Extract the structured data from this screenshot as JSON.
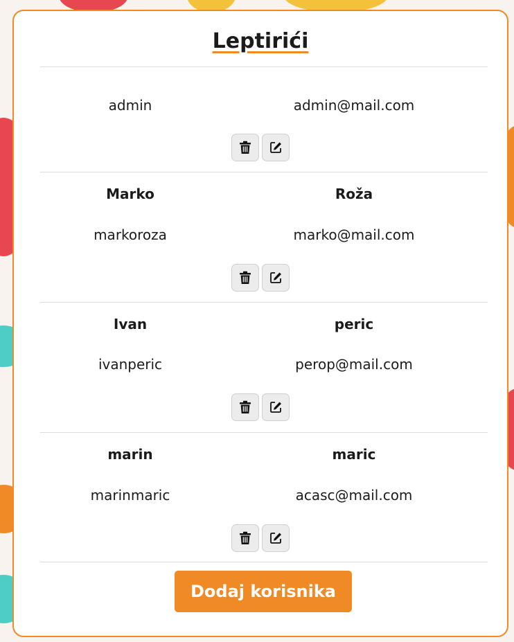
{
  "card": {
    "title": "Leptirići"
  },
  "users": [
    {
      "first_name": "",
      "last_name": "",
      "username": "admin",
      "email": "admin@mail.com"
    },
    {
      "first_name": "Marko",
      "last_name": "Roža",
      "username": "markoroza",
      "email": "marko@mail.com"
    },
    {
      "first_name": "Ivan",
      "last_name": "peric",
      "username": "ivanperic",
      "email": "perop@mail.com"
    },
    {
      "first_name": "marin",
      "last_name": "maric",
      "username": "marinmaric",
      "email": "acasc@mail.com"
    }
  ],
  "icons": {
    "delete": "trash-icon",
    "edit": "edit-icon"
  },
  "add_button_label": "Dodaj korisnika",
  "colors": {
    "accent": "#f08a24",
    "background": "#f8f3ee",
    "blob_red": "#e8474f",
    "blob_teal": "#4ecdc4",
    "blob_yellow": "#f4c13a"
  }
}
